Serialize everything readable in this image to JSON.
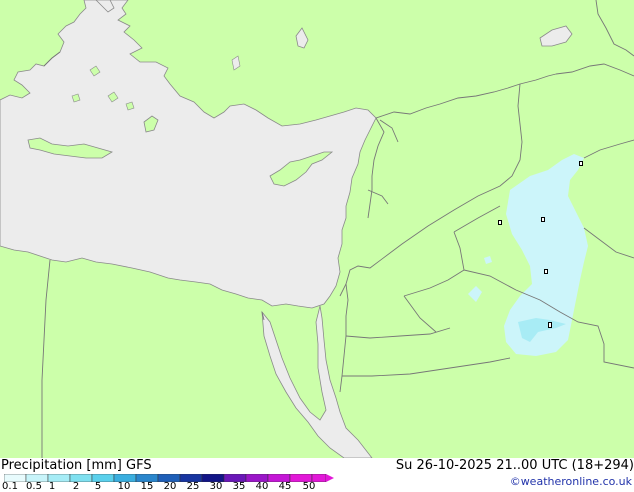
{
  "map": {
    "colors": {
      "land": "#ccffaa",
      "sea": "#ececec",
      "border": "#777777",
      "coast": "#8a8a8a",
      "precip_light": "#ccf5fa",
      "precip_medium": "#a8ecf5",
      "station": "#000000"
    },
    "station_count": 5
  },
  "footer": {
    "title": "Precipitation [mm]  GFS",
    "valid_time": "Su 26-10-2025 21..00 UTC (18+294)",
    "credit": "©weatheronline.co.uk"
  },
  "legend": {
    "labels": [
      "0.1",
      "0.5",
      "1",
      "2",
      "5",
      "10",
      "15",
      "20",
      "25",
      "30",
      "35",
      "40",
      "45",
      "50"
    ],
    "colors": [
      "#e8fbfd",
      "#c8f4fa",
      "#a6ecf6",
      "#7fe0f0",
      "#5ad0ec",
      "#3aaedf",
      "#2a86cc",
      "#1f5fb8",
      "#1835a0",
      "#121587",
      "#6a17b8",
      "#9a16c8",
      "#c416d6",
      "#e218d8",
      "#e218d8"
    ]
  }
}
